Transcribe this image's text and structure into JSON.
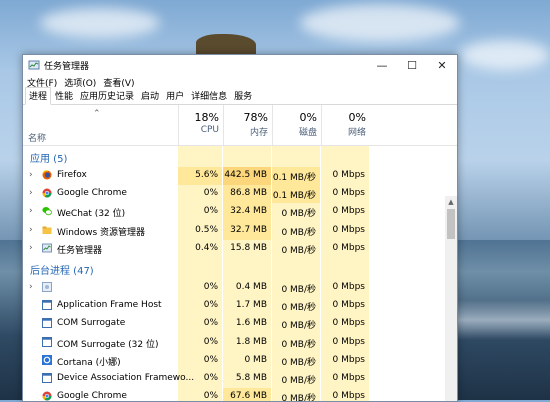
{
  "window": {
    "title": "任务管理器",
    "controls": [
      "—",
      "☐",
      "✕"
    ]
  },
  "menu": [
    "文件(F)",
    "选项(O)",
    "查看(V)"
  ],
  "tabs": [
    "进程",
    "性能",
    "应用历史记录",
    "启动",
    "用户",
    "详细信息",
    "服务"
  ],
  "columns": {
    "name": "名称",
    "cpu": {
      "pct": "18%",
      "label": "CPU"
    },
    "memory": {
      "pct": "78%",
      "label": "内存"
    },
    "disk": {
      "pct": "0%",
      "label": "磁盘"
    },
    "network": {
      "pct": "0%",
      "label": "网络"
    }
  },
  "groups": {
    "apps": "应用 (5)",
    "background": "后台进程 (47)"
  },
  "apps": [
    {
      "name": "Firefox",
      "cpu": "5.6%",
      "mem": "442.5 MB",
      "disk": "0.1 MB/秒",
      "net": "0 Mbps",
      "icon": "firefox-icon"
    },
    {
      "name": "Google Chrome",
      "cpu": "0%",
      "mem": "86.8 MB",
      "disk": "0.1 MB/秒",
      "net": "0 Mbps",
      "icon": "chrome-icon"
    },
    {
      "name": "WeChat (32 位)",
      "cpu": "0%",
      "mem": "32.4 MB",
      "disk": "0 MB/秒",
      "net": "0 Mbps",
      "icon": "wechat-icon"
    },
    {
      "name": "Windows 资源管理器",
      "cpu": "0.5%",
      "mem": "32.7 MB",
      "disk": "0 MB/秒",
      "net": "0 Mbps",
      "icon": "explorer-icon"
    },
    {
      "name": "任务管理器",
      "cpu": "0.4%",
      "mem": "15.8 MB",
      "disk": "0 MB/秒",
      "net": "0 Mbps",
      "icon": "taskmgr-icon"
    }
  ],
  "background": [
    {
      "name": "",
      "cpu": "0%",
      "mem": "0.4 MB",
      "disk": "0 MB/秒",
      "net": "0 Mbps",
      "icon": "generic-app-icon",
      "chevron": true
    },
    {
      "name": "Application Frame Host",
      "cpu": "0%",
      "mem": "1.7 MB",
      "disk": "0 MB/秒",
      "net": "0 Mbps",
      "icon": "window-frame-icon"
    },
    {
      "name": "COM Surrogate",
      "cpu": "0%",
      "mem": "1.6 MB",
      "disk": "0 MB/秒",
      "net": "0 Mbps",
      "icon": "window-frame-icon"
    },
    {
      "name": "COM Surrogate (32 位)",
      "cpu": "0%",
      "mem": "1.8 MB",
      "disk": "0 MB/秒",
      "net": "0 Mbps",
      "icon": "window-frame-icon"
    },
    {
      "name": "Cortana (小娜)",
      "cpu": "0%",
      "mem": "0 MB",
      "disk": "0 MB/秒",
      "net": "0 Mbps",
      "icon": "cortana-icon"
    },
    {
      "name": "Device Association Framewo...",
      "cpu": "0%",
      "mem": "5.8 MB",
      "disk": "0 MB/秒",
      "net": "0 Mbps",
      "icon": "window-frame-icon"
    },
    {
      "name": "Google Chrome",
      "cpu": "0%",
      "mem": "67.6 MB",
      "disk": "0 MB/秒",
      "net": "0 Mbps",
      "icon": "chrome-icon"
    }
  ],
  "colors": {
    "accent": "#2467b3",
    "heat_light": "#fff4c4",
    "heat_mid": "#ffe89a",
    "heat_strong": "#fbd67a"
  }
}
